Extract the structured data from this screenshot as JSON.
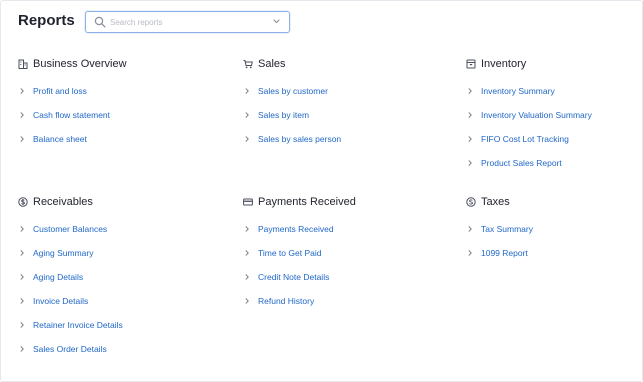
{
  "header": {
    "title": "Reports",
    "search_placeholder": "Search reports"
  },
  "sections": [
    {
      "title": "Business Overview",
      "icon": "building-icon",
      "items": [
        "Profit and loss",
        "Cash flow statement",
        "Balance sheet"
      ]
    },
    {
      "title": "Sales",
      "icon": "cart-icon",
      "items": [
        "Sales by customer",
        "Sales by item",
        "Sales by sales person"
      ]
    },
    {
      "title": "Inventory",
      "icon": "inventory-icon",
      "items": [
        "Inventory Summary",
        "Inventory Valuation Summary",
        "FIFO Cost Lot Tracking",
        "Product Sales Report"
      ]
    },
    {
      "title": "Receivables",
      "icon": "dollar-circle-icon",
      "items": [
        "Customer Balances",
        "Aging Summary",
        "Aging Details",
        "Invoice Details",
        "Retainer Invoice Details",
        "Sales Order Details"
      ]
    },
    {
      "title": "Payments Received",
      "icon": "card-icon",
      "items": [
        "Payments Received",
        "Time to Get Paid",
        "Credit Note Details",
        "Refund History"
      ]
    },
    {
      "title": "Taxes",
      "icon": "tax-icon",
      "items": [
        "Tax Summary",
        "1099 Report"
      ]
    }
  ],
  "colors": {
    "link": "#2168c8",
    "title": "#1f2330",
    "search_border": "#8fb0e6"
  }
}
